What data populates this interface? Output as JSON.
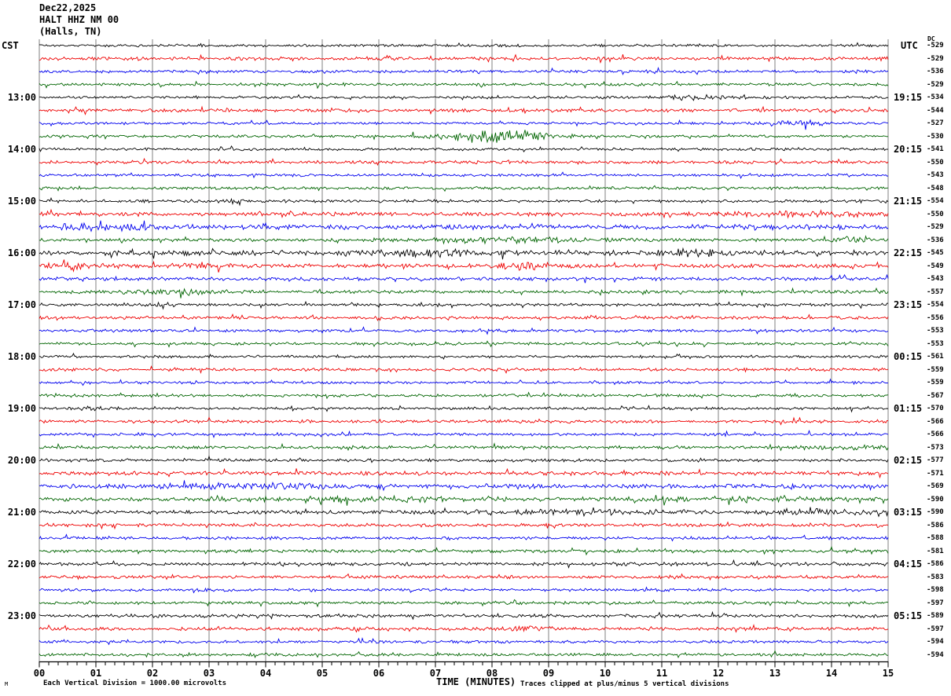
{
  "header": {
    "date": "Dec22,2025",
    "station": "HALT HHZ NM 00",
    "location": "(Halls, TN)",
    "left_tz": "CST",
    "right_tz": "UTC",
    "dc_label": "DC"
  },
  "footer": {
    "watermark": "M",
    "scale_note": "Each Vertical Division = 1000.00 microvolts",
    "xaxis_title": "TIME (MINUTES)",
    "clip_note": "Traces clipped at plus/minus 5 vertical divisions"
  },
  "chart_data": {
    "type": "line",
    "title": "HALT HHZ NM 00 (Halls, TN) helicorder, Dec22,2025",
    "xlabel": "TIME (MINUTES)",
    "x_range_minutes": [
      0,
      15
    ],
    "x_ticks": [
      "00",
      "01",
      "02",
      "03",
      "04",
      "05",
      "06",
      "07",
      "08",
      "09",
      "10",
      "11",
      "12",
      "13",
      "14",
      "15"
    ],
    "minor_ticks_per_minute": 6,
    "grid": "vertical lines each minute",
    "scale_note_microvolts_per_division": 1000.0,
    "clip_divisions": 5,
    "trace_colors": {
      "black": "#000000",
      "red": "#ee0000",
      "blue": "#0000ee",
      "green": "#006400"
    },
    "grid_color": "#808080",
    "axis_color": "#000000",
    "traces": [
      {
        "color": "black",
        "dc": "-529",
        "cst": "",
        "utc": "",
        "noise": 1.2,
        "bursts": []
      },
      {
        "color": "red",
        "dc": "-529",
        "cst": "",
        "utc": "",
        "noise": 1.5,
        "bursts": []
      },
      {
        "color": "blue",
        "dc": "-536",
        "cst": "",
        "utc": "",
        "noise": 1.3,
        "bursts": []
      },
      {
        "color": "green",
        "dc": "-529",
        "cst": "",
        "utc": "",
        "noise": 1.3,
        "bursts": []
      },
      {
        "color": "black",
        "dc": "-534",
        "cst": "13:00",
        "utc": "19:15",
        "noise": 1.2,
        "bursts": [
          [
            10.8,
            12.6,
            1.8
          ]
        ]
      },
      {
        "color": "red",
        "dc": "-544",
        "cst": "",
        "utc": "",
        "noise": 1.5,
        "bursts": []
      },
      {
        "color": "blue",
        "dc": "-527",
        "cst": "",
        "utc": "",
        "noise": 1.2,
        "bursts": [
          [
            12.7,
            14.1,
            2.2
          ]
        ]
      },
      {
        "color": "green",
        "dc": "-530",
        "cst": "",
        "utc": "",
        "noise": 1.2,
        "bursts": [
          [
            6.9,
            9.4,
            5.5
          ]
        ]
      },
      {
        "color": "black",
        "dc": "-541",
        "cst": "14:00",
        "utc": "20:15",
        "noise": 1.2,
        "bursts": []
      },
      {
        "color": "red",
        "dc": "-550",
        "cst": "",
        "utc": "",
        "noise": 1.4,
        "bursts": []
      },
      {
        "color": "blue",
        "dc": "-543",
        "cst": "",
        "utc": "",
        "noise": 1.2,
        "bursts": []
      },
      {
        "color": "green",
        "dc": "-548",
        "cst": "",
        "utc": "",
        "noise": 1.3,
        "bursts": []
      },
      {
        "color": "black",
        "dc": "-554",
        "cst": "15:00",
        "utc": "21:15",
        "noise": 1.3,
        "bursts": [
          [
            3.2,
            3.6,
            1.5
          ]
        ]
      },
      {
        "color": "red",
        "dc": "-550",
        "cst": "",
        "utc": "",
        "noise": 1.8,
        "bursts": [
          [
            12.0,
            15.0,
            1.5
          ]
        ]
      },
      {
        "color": "blue",
        "dc": "-529",
        "cst": "",
        "utc": "",
        "noise": 2.2,
        "bursts": [
          [
            0.0,
            2.4,
            1.5
          ]
        ]
      },
      {
        "color": "green",
        "dc": "-536",
        "cst": "",
        "utc": "",
        "noise": 1.5,
        "bursts": [
          [
            6.0,
            10.5,
            1.5
          ],
          [
            14.0,
            14.9,
            2.0
          ]
        ]
      },
      {
        "color": "black",
        "dc": "-545",
        "cst": "16:00",
        "utc": "22:15",
        "noise": 2.2,
        "bursts": [
          [
            4.8,
            8.5,
            1.5
          ],
          [
            10.8,
            12.3,
            1.8
          ]
        ]
      },
      {
        "color": "red",
        "dc": "-549",
        "cst": "",
        "utc": "",
        "noise": 1.8,
        "bursts": [
          [
            0.0,
            0.9,
            3.5
          ],
          [
            2.4,
            3.3,
            2.5
          ],
          [
            8.0,
            9.1,
            2.5
          ]
        ]
      },
      {
        "color": "blue",
        "dc": "-543",
        "cst": "",
        "utc": "",
        "noise": 1.6,
        "bursts": []
      },
      {
        "color": "green",
        "dc": "-557",
        "cst": "",
        "utc": "",
        "noise": 1.5,
        "bursts": [
          [
            1.3,
            3.3,
            2.0
          ]
        ]
      },
      {
        "color": "black",
        "dc": "-554",
        "cst": "17:00",
        "utc": "23:15",
        "noise": 1.3,
        "bursts": [
          [
            2.0,
            2.4,
            1.5
          ]
        ]
      },
      {
        "color": "red",
        "dc": "-556",
        "cst": "",
        "utc": "",
        "noise": 1.4,
        "bursts": []
      },
      {
        "color": "blue",
        "dc": "-553",
        "cst": "",
        "utc": "",
        "noise": 1.3,
        "bursts": []
      },
      {
        "color": "green",
        "dc": "-553",
        "cst": "",
        "utc": "",
        "noise": 1.3,
        "bursts": []
      },
      {
        "color": "black",
        "dc": "-561",
        "cst": "18:00",
        "utc": "00:15",
        "noise": 1.2,
        "bursts": []
      },
      {
        "color": "red",
        "dc": "-559",
        "cst": "",
        "utc": "",
        "noise": 1.4,
        "bursts": []
      },
      {
        "color": "blue",
        "dc": "-559",
        "cst": "",
        "utc": "",
        "noise": 1.2,
        "bursts": []
      },
      {
        "color": "green",
        "dc": "-567",
        "cst": "",
        "utc": "",
        "noise": 1.3,
        "bursts": []
      },
      {
        "color": "black",
        "dc": "-570",
        "cst": "19:00",
        "utc": "01:15",
        "noise": 1.2,
        "bursts": [
          [
            0.7,
            1.2,
            1.8
          ]
        ]
      },
      {
        "color": "red",
        "dc": "-566",
        "cst": "",
        "utc": "",
        "noise": 1.4,
        "bursts": []
      },
      {
        "color": "blue",
        "dc": "-566",
        "cst": "",
        "utc": "",
        "noise": 1.3,
        "bursts": []
      },
      {
        "color": "green",
        "dc": "-573",
        "cst": "",
        "utc": "",
        "noise": 1.4,
        "bursts": [
          [
            13.5,
            15.0,
            1.2
          ]
        ]
      },
      {
        "color": "black",
        "dc": "-577",
        "cst": "20:00",
        "utc": "02:15",
        "noise": 1.4,
        "bursts": []
      },
      {
        "color": "red",
        "dc": "-571",
        "cst": "",
        "utc": "",
        "noise": 1.8,
        "bursts": []
      },
      {
        "color": "blue",
        "dc": "-569",
        "cst": "",
        "utc": "",
        "noise": 1.8,
        "bursts": [
          [
            1.5,
            5.8,
            1.4
          ]
        ]
      },
      {
        "color": "green",
        "dc": "-590",
        "cst": "",
        "utc": "",
        "noise": 1.6,
        "bursts": [
          [
            3.0,
            8.5,
            1.5
          ],
          [
            10.0,
            14.5,
            1.5
          ]
        ]
      },
      {
        "color": "black",
        "dc": "-590",
        "cst": "21:00",
        "utc": "03:15",
        "noise": 1.6,
        "bursts": [
          [
            7.5,
            11.3,
            1.3
          ],
          [
            12.5,
            15.0,
            1.5
          ]
        ]
      },
      {
        "color": "red",
        "dc": "-586",
        "cst": "",
        "utc": "",
        "noise": 1.5,
        "bursts": []
      },
      {
        "color": "blue",
        "dc": "-588",
        "cst": "",
        "utc": "",
        "noise": 1.3,
        "bursts": []
      },
      {
        "color": "green",
        "dc": "-581",
        "cst": "",
        "utc": "",
        "noise": 1.4,
        "bursts": []
      },
      {
        "color": "black",
        "dc": "-586",
        "cst": "22:00",
        "utc": "04:15",
        "noise": 1.5,
        "bursts": []
      },
      {
        "color": "red",
        "dc": "-583",
        "cst": "",
        "utc": "",
        "noise": 1.4,
        "bursts": []
      },
      {
        "color": "blue",
        "dc": "-598",
        "cst": "",
        "utc": "",
        "noise": 1.3,
        "bursts": []
      },
      {
        "color": "green",
        "dc": "-597",
        "cst": "",
        "utc": "",
        "noise": 1.3,
        "bursts": []
      },
      {
        "color": "black",
        "dc": "-589",
        "cst": "23:00",
        "utc": "05:15",
        "noise": 1.5,
        "bursts": []
      },
      {
        "color": "red",
        "dc": "-597",
        "cst": "",
        "utc": "",
        "noise": 1.5,
        "bursts": [
          [
            8.2,
            9.2,
            2.0
          ]
        ]
      },
      {
        "color": "blue",
        "dc": "-594",
        "cst": "",
        "utc": "",
        "noise": 1.3,
        "bursts": []
      },
      {
        "color": "green",
        "dc": "-594",
        "cst": "",
        "utc": "",
        "noise": 1.3,
        "bursts": []
      }
    ]
  }
}
